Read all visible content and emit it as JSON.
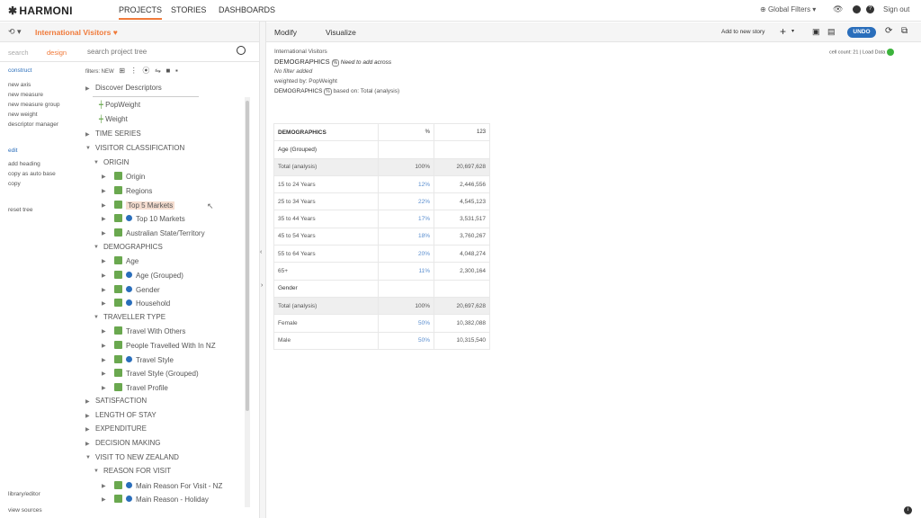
{
  "app": {
    "logo": "HARMONI"
  },
  "nav": {
    "projects": "PROJECTS",
    "stories": "STORIES",
    "dashboards": "DASHBOARDS"
  },
  "topright": {
    "global_filters": "Global Filters",
    "sign_out": "Sign out"
  },
  "project": {
    "name": "International Visitors",
    "history_icon": "history-icon"
  },
  "search": {
    "mode_search": "search",
    "mode_design": "design",
    "placeholder": "search project tree"
  },
  "leftlinks": {
    "construct": "construct",
    "new_axis": "new axis",
    "new_measure": "new measure",
    "new_measure_group": "new measure group",
    "new_weight": "new weight",
    "descriptor_manager": "descriptor manager",
    "edit": "edit",
    "add_heading": "add heading",
    "copy_as_auto_base": "copy as auto base",
    "copy": "copy",
    "reset_tree": "reset tree",
    "library_editor": "library/editor",
    "view_sources": "view sources"
  },
  "filters": {
    "label": "filters: NEW"
  },
  "tree": {
    "discover": "Discover Descriptors",
    "popweight": "PopWeight",
    "weight": "Weight",
    "time_series": "TIME SERIES",
    "visitor_classification": "VISITOR CLASSIFICATION",
    "origin_group": "ORIGIN",
    "origin": "Origin",
    "regions": "Regions",
    "top5": "Top 5 Markets",
    "top10": "Top 10 Markets",
    "aus_state": "Australian State/Territory",
    "demographics_group": "DEMOGRAPHICS",
    "age": "Age",
    "age_grouped": "Age (Grouped)",
    "gender": "Gender",
    "household": "Household",
    "traveller_type": "TRAVELLER TYPE",
    "travel_with_others": "Travel With Others",
    "people_travelled": "People Travelled With In NZ",
    "travel_style": "Travel Style",
    "travel_style_grouped": "Travel Style (Grouped)",
    "travel_profile": "Travel Profile",
    "satisfaction": "SATISFACTION",
    "length_of_stay": "LENGTH OF STAY",
    "expenditure": "EXPENDITURE",
    "decision_making": "DECISION MAKING",
    "visit_to_nz": "VISIT TO NEW ZEALAND",
    "reason_for_visit": "REASON FOR VISIT",
    "main_reason_nz": "Main Reason For Visit - NZ",
    "main_reason_holiday": "Main Reason - Holiday"
  },
  "tabs": {
    "modify": "Modify",
    "visualize": "Visualize",
    "add_to_story": "Add to new story",
    "undo": "UNDO"
  },
  "info": {
    "title": "International Visitors",
    "heading": "DEMOGRAPHICS",
    "need": "Need to add across",
    "nofilter": "No filter added",
    "weighted": "weighted by: PopWeight",
    "based_on_label": "DEMOGRAPHICS",
    "based_on_text": "based on: Total (analysis)",
    "cell_count": "cell count: 21 | Load Data"
  },
  "table": {
    "header": {
      "title": "DEMOGRAPHICS",
      "col_pct": "%",
      "col_num": "123"
    },
    "rows": [
      {
        "label": "Age (Grouped)",
        "pct": "",
        "num": "",
        "type": "section"
      },
      {
        "label": "Total (analysis)",
        "pct": "100%",
        "num": "20,697,628",
        "type": "total"
      },
      {
        "label": "15 to 24 Years",
        "pct": "12%",
        "num": "2,446,556",
        "type": "data"
      },
      {
        "label": "25 to 34 Years",
        "pct": "22%",
        "num": "4,545,123",
        "type": "data"
      },
      {
        "label": "35 to 44 Years",
        "pct": "17%",
        "num": "3,531,517",
        "type": "data"
      },
      {
        "label": "45 to 54 Years",
        "pct": "18%",
        "num": "3,760,267",
        "type": "data"
      },
      {
        "label": "55 to 64 Years",
        "pct": "20%",
        "num": "4,048,274",
        "type": "data"
      },
      {
        "label": "65+",
        "pct": "11%",
        "num": "2,300,164",
        "type": "data"
      },
      {
        "label": "Gender",
        "pct": "",
        "num": "",
        "type": "section"
      },
      {
        "label": "Total (analysis)",
        "pct": "100%",
        "num": "20,697,628",
        "type": "total"
      },
      {
        "label": "Female",
        "pct": "50%",
        "num": "10,382,088",
        "type": "data"
      },
      {
        "label": "Male",
        "pct": "50%",
        "num": "10,315,540",
        "type": "data"
      }
    ]
  },
  "colors": {
    "accent": "#f07a3a",
    "blue": "#2a6ebb",
    "green": "#6aa84f"
  }
}
